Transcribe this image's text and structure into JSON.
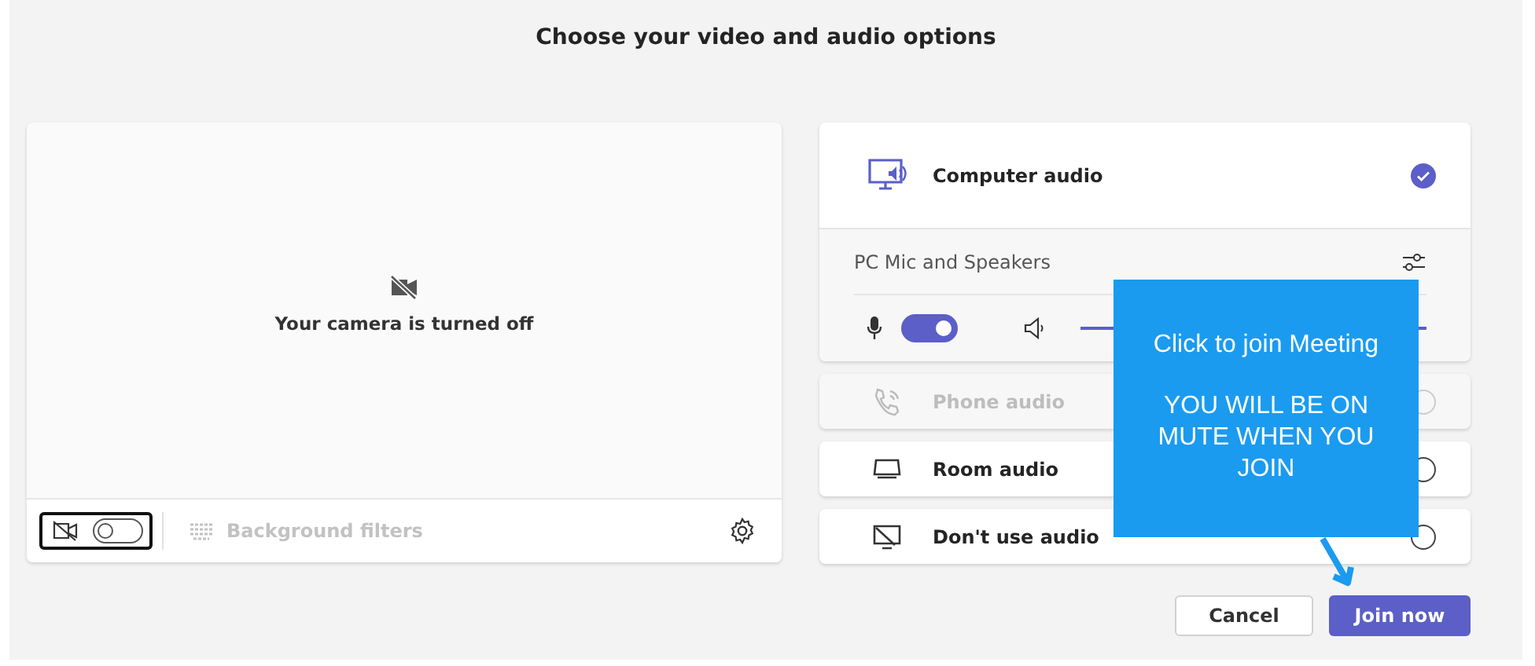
{
  "title": "Choose your video and audio options",
  "camera": {
    "on": false,
    "message": "Your camera is turned off"
  },
  "background_filters": {
    "label": "Background filters",
    "disabled": true
  },
  "audio_options": [
    {
      "kind": "computer",
      "label": "Computer audio",
      "selected": true,
      "disabled": false
    },
    {
      "kind": "phone",
      "label": "Phone audio",
      "selected": false,
      "disabled": true
    },
    {
      "kind": "room",
      "label": "Room audio",
      "selected": false,
      "disabled": false
    },
    {
      "kind": "none",
      "label": "Don't use audio",
      "selected": false,
      "disabled": false
    }
  ],
  "device": {
    "name": "PC Mic and Speakers",
    "mic_on": true
  },
  "buttons": [
    {
      "kind": "secondary",
      "label": "Cancel"
    },
    {
      "kind": "primary",
      "label": "Join now"
    }
  ],
  "callout": {
    "lines": [
      "Click to join Meeting",
      "YOU WILL BE ON MUTE WHEN YOU JOIN"
    ]
  }
}
